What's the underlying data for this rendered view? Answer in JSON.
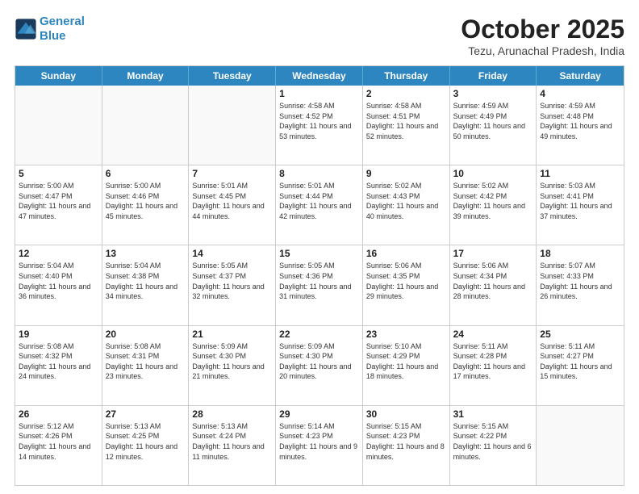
{
  "header": {
    "logo_line1": "General",
    "logo_line2": "Blue",
    "title": "October 2025",
    "subtitle": "Tezu, Arunachal Pradesh, India"
  },
  "weekdays": [
    "Sunday",
    "Monday",
    "Tuesday",
    "Wednesday",
    "Thursday",
    "Friday",
    "Saturday"
  ],
  "weeks": [
    [
      {
        "day": "",
        "empty": true
      },
      {
        "day": "",
        "empty": true
      },
      {
        "day": "",
        "empty": true
      },
      {
        "day": "1",
        "sunrise": "4:58 AM",
        "sunset": "4:52 PM",
        "daylight": "11 hours and 53 minutes."
      },
      {
        "day": "2",
        "sunrise": "4:58 AM",
        "sunset": "4:51 PM",
        "daylight": "11 hours and 52 minutes."
      },
      {
        "day": "3",
        "sunrise": "4:59 AM",
        "sunset": "4:49 PM",
        "daylight": "11 hours and 50 minutes."
      },
      {
        "day": "4",
        "sunrise": "4:59 AM",
        "sunset": "4:48 PM",
        "daylight": "11 hours and 49 minutes."
      }
    ],
    [
      {
        "day": "5",
        "sunrise": "5:00 AM",
        "sunset": "4:47 PM",
        "daylight": "11 hours and 47 minutes."
      },
      {
        "day": "6",
        "sunrise": "5:00 AM",
        "sunset": "4:46 PM",
        "daylight": "11 hours and 45 minutes."
      },
      {
        "day": "7",
        "sunrise": "5:01 AM",
        "sunset": "4:45 PM",
        "daylight": "11 hours and 44 minutes."
      },
      {
        "day": "8",
        "sunrise": "5:01 AM",
        "sunset": "4:44 PM",
        "daylight": "11 hours and 42 minutes."
      },
      {
        "day": "9",
        "sunrise": "5:02 AM",
        "sunset": "4:43 PM",
        "daylight": "11 hours and 40 minutes."
      },
      {
        "day": "10",
        "sunrise": "5:02 AM",
        "sunset": "4:42 PM",
        "daylight": "11 hours and 39 minutes."
      },
      {
        "day": "11",
        "sunrise": "5:03 AM",
        "sunset": "4:41 PM",
        "daylight": "11 hours and 37 minutes."
      }
    ],
    [
      {
        "day": "12",
        "sunrise": "5:04 AM",
        "sunset": "4:40 PM",
        "daylight": "11 hours and 36 minutes."
      },
      {
        "day": "13",
        "sunrise": "5:04 AM",
        "sunset": "4:38 PM",
        "daylight": "11 hours and 34 minutes."
      },
      {
        "day": "14",
        "sunrise": "5:05 AM",
        "sunset": "4:37 PM",
        "daylight": "11 hours and 32 minutes."
      },
      {
        "day": "15",
        "sunrise": "5:05 AM",
        "sunset": "4:36 PM",
        "daylight": "11 hours and 31 minutes."
      },
      {
        "day": "16",
        "sunrise": "5:06 AM",
        "sunset": "4:35 PM",
        "daylight": "11 hours and 29 minutes."
      },
      {
        "day": "17",
        "sunrise": "5:06 AM",
        "sunset": "4:34 PM",
        "daylight": "11 hours and 28 minutes."
      },
      {
        "day": "18",
        "sunrise": "5:07 AM",
        "sunset": "4:33 PM",
        "daylight": "11 hours and 26 minutes."
      }
    ],
    [
      {
        "day": "19",
        "sunrise": "5:08 AM",
        "sunset": "4:32 PM",
        "daylight": "11 hours and 24 minutes."
      },
      {
        "day": "20",
        "sunrise": "5:08 AM",
        "sunset": "4:31 PM",
        "daylight": "11 hours and 23 minutes."
      },
      {
        "day": "21",
        "sunrise": "5:09 AM",
        "sunset": "4:30 PM",
        "daylight": "11 hours and 21 minutes."
      },
      {
        "day": "22",
        "sunrise": "5:09 AM",
        "sunset": "4:30 PM",
        "daylight": "11 hours and 20 minutes."
      },
      {
        "day": "23",
        "sunrise": "5:10 AM",
        "sunset": "4:29 PM",
        "daylight": "11 hours and 18 minutes."
      },
      {
        "day": "24",
        "sunrise": "5:11 AM",
        "sunset": "4:28 PM",
        "daylight": "11 hours and 17 minutes."
      },
      {
        "day": "25",
        "sunrise": "5:11 AM",
        "sunset": "4:27 PM",
        "daylight": "11 hours and 15 minutes."
      }
    ],
    [
      {
        "day": "26",
        "sunrise": "5:12 AM",
        "sunset": "4:26 PM",
        "daylight": "11 hours and 14 minutes."
      },
      {
        "day": "27",
        "sunrise": "5:13 AM",
        "sunset": "4:25 PM",
        "daylight": "11 hours and 12 minutes."
      },
      {
        "day": "28",
        "sunrise": "5:13 AM",
        "sunset": "4:24 PM",
        "daylight": "11 hours and 11 minutes."
      },
      {
        "day": "29",
        "sunrise": "5:14 AM",
        "sunset": "4:23 PM",
        "daylight": "11 hours and 9 minutes."
      },
      {
        "day": "30",
        "sunrise": "5:15 AM",
        "sunset": "4:23 PM",
        "daylight": "11 hours and 8 minutes."
      },
      {
        "day": "31",
        "sunrise": "5:15 AM",
        "sunset": "4:22 PM",
        "daylight": "11 hours and 6 minutes."
      },
      {
        "day": "",
        "empty": true
      }
    ]
  ]
}
